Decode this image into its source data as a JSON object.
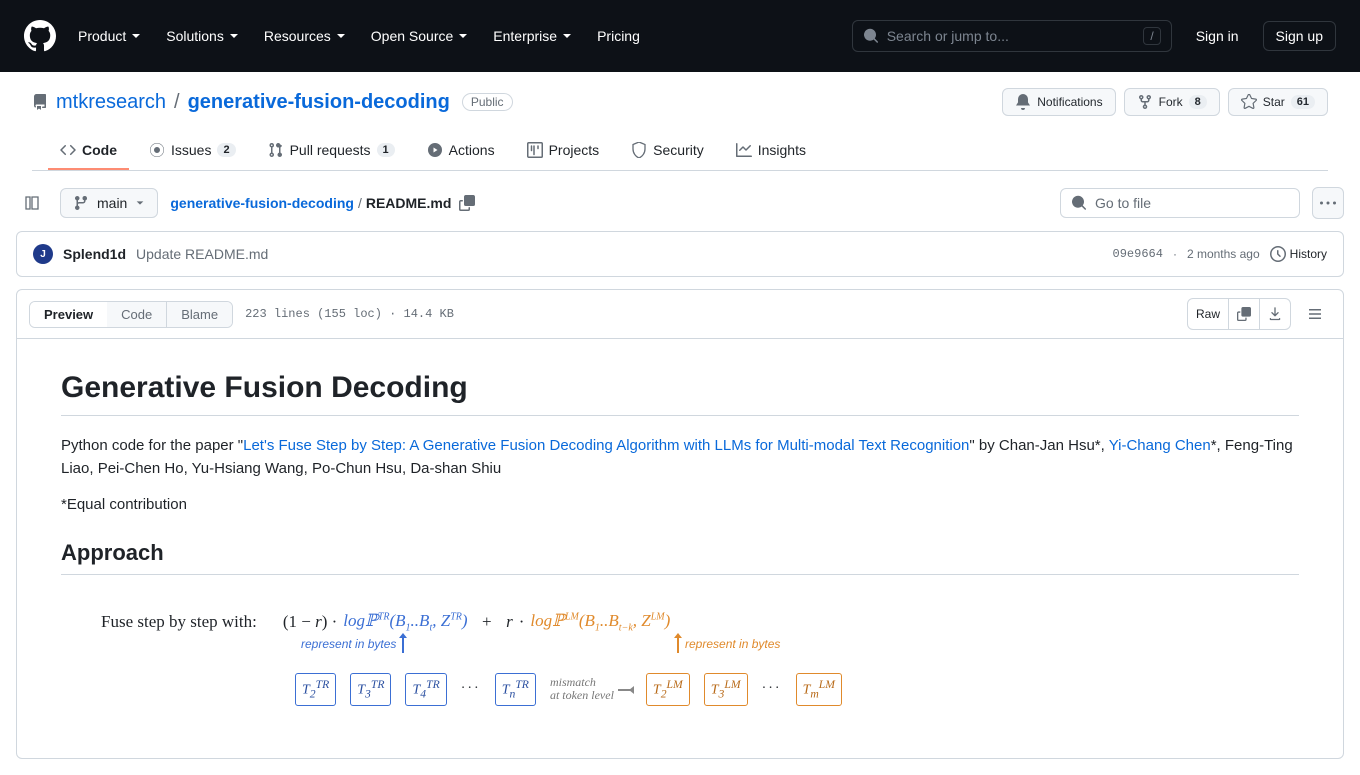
{
  "header": {
    "nav": [
      "Product",
      "Solutions",
      "Resources",
      "Open Source",
      "Enterprise",
      "Pricing"
    ],
    "search_placeholder": "Search or jump to...",
    "slash": "/",
    "sign_in": "Sign in",
    "sign_up": "Sign up"
  },
  "repo": {
    "owner": "mtkresearch",
    "name": "generative-fusion-decoding",
    "visibility": "Public",
    "actions": {
      "notifications": "Notifications",
      "fork": "Fork",
      "fork_count": "8",
      "star": "Star",
      "star_count": "61"
    },
    "tabs": [
      {
        "label": "Code",
        "active": true
      },
      {
        "label": "Issues",
        "count": "2"
      },
      {
        "label": "Pull requests",
        "count": "1"
      },
      {
        "label": "Actions"
      },
      {
        "label": "Projects"
      },
      {
        "label": "Security"
      },
      {
        "label": "Insights"
      }
    ]
  },
  "file": {
    "branch": "main",
    "breadcrumb_root": "generative-fusion-decoding",
    "breadcrumb_file": "README.md",
    "goto_placeholder": "Go to file",
    "commit": {
      "author": "Splend1d",
      "message": "Update README.md",
      "sha": "09e9664",
      "time": "2 months ago",
      "history": "History"
    },
    "views": {
      "preview": "Preview",
      "code": "Code",
      "blame": "Blame"
    },
    "stats": "223 lines (155 loc) · 14.4 KB",
    "raw": "Raw"
  },
  "readme": {
    "title": "Generative Fusion Decoding",
    "intro_pre": "Python code for the paper \"",
    "paper_link": "Let's Fuse Step by Step: A Generative Fusion Decoding Algorithm with LLMs for Multi-modal Text Recognition",
    "intro_post": "\" by Chan-Jan Hsu*, ",
    "author_link": "Yi-Chang Chen",
    "intro_tail": "*, Feng-Ting Liao, Pei-Chen Ho, Yu-Hsiang Wang, Po-Chun Hsu, Da-shan Shiu",
    "equal": "*Equal contribution",
    "approach": "Approach",
    "fig": {
      "label": "Fuse step by step with:",
      "annot_blue": "represent in bytes",
      "annot_orange": "represent in bytes",
      "mismatch_l1": "mismatch",
      "mismatch_l2": "at token level"
    }
  }
}
